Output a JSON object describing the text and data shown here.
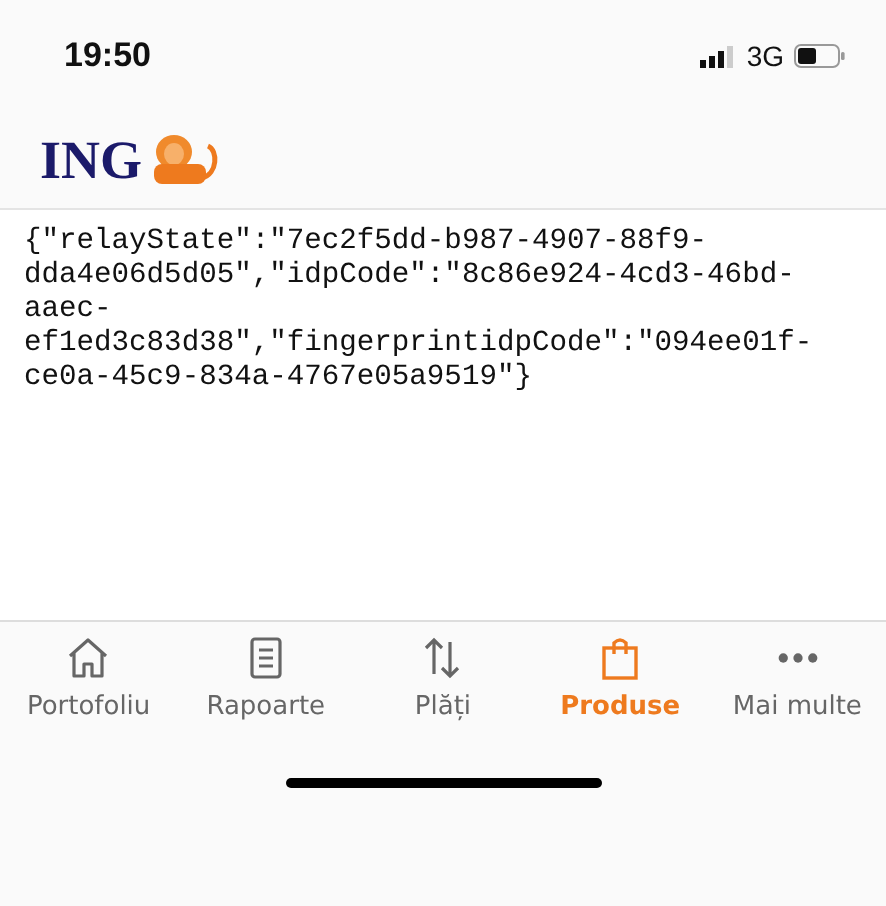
{
  "status_bar": {
    "time": "19:50",
    "network": "3G"
  },
  "header": {
    "logo_text": "ING"
  },
  "content": {
    "lines": [
      "{\"relayState\":\"7ec2f5dd-b987-4907-88f9-",
      "dda4e06d5d05\",\"idpCode\":\"8c86e924-4cd3-46bd-",
      "aaec-",
      "ef1ed3c83d38\",\"fingerprintidpCode\":\"094ee01f-",
      "ce0a-45c9-834a-4767e05a9519\"}"
    ]
  },
  "tab_bar": [
    {
      "kind": "home",
      "label": "Portofoliu",
      "selected": false
    },
    {
      "kind": "report",
      "label": "Rapoarte",
      "selected": false
    },
    {
      "kind": "transfer",
      "label": "Plăți",
      "selected": false
    },
    {
      "kind": "bag",
      "label": "Produse",
      "selected": true
    },
    {
      "kind": "more",
      "label": "Mai multe",
      "selected": false
    }
  ]
}
